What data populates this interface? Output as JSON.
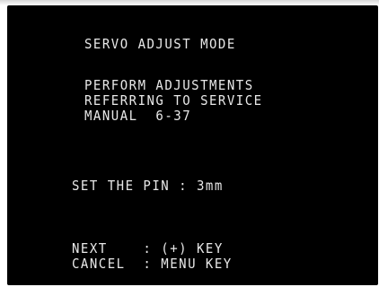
{
  "screen": {
    "title": "SERVO ADJUST MODE",
    "message_lines": [
      "PERFORM ADJUSTMENTS",
      "REFERRING TO SERVICE",
      "MANUAL  6-37"
    ],
    "setting": "SET THE PIN : 3mm",
    "keys": {
      "next": "NEXT    : (+) KEY",
      "cancel": "CANCEL  : MENU KEY"
    }
  },
  "colors": {
    "background": "#000000",
    "text": "#e8e8e8"
  }
}
